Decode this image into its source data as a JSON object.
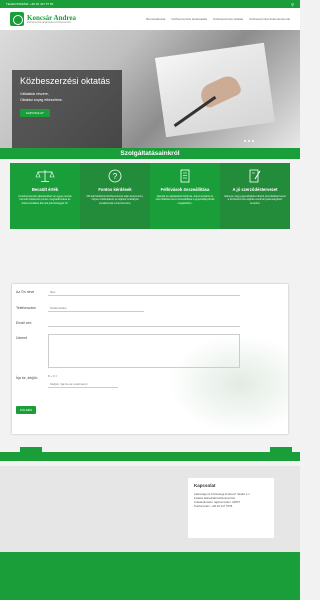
{
  "topbar": {
    "label": "TELEFONSZÁM:",
    "phone": "+36 20 417 57 56",
    "search_icon": "search-icon"
  },
  "header": {
    "logo_name": "Koncsár Andrea",
    "logo_sub": "közbeszerzési tanácsadó és közbeszerzési",
    "nav": [
      "Bemutatkozás",
      "Közbeszerzési tanácsadás",
      "Közbeszerzési oktatás",
      "Közbeszerzési dokumentumok"
    ]
  },
  "hero": {
    "title": "Közbeszerzési oktatás",
    "lines": [
      "Vállalatok részére,",
      "Oktatási anyag elkészítése."
    ],
    "button": "KAPCSOLAT"
  },
  "services": {
    "title": "Szolgáltatásainkról",
    "items": [
      {
        "title": "Becsült érték",
        "text": "A közbeszerzési eljárásokban az egyes részek becsült értékének pontos meghatározása és dokumentálása kiemelt jelentőséggel bír."
      },
      {
        "title": "Fontos kérdések",
        "text": "Mit kell feltétlenül közbeszerzés útján beszerezni, milyen értékhatárok és eljárási szabályok vonatkoznak a beszerzésre."
      },
      {
        "title": "Felhívások összeállítása",
        "text": "Ajánlati és ajánlattételi felhívás, dokumentáció és szerződéstervezet összeállítása a jogszabályoknak megfelelően."
      },
      {
        "title": "A jó szerződéstervezet",
        "text": "Hiányos vagy jogszabályba ütköző szerződéstervezet a közbeszerzési eljárás eredménytelenségéhez vezethet."
      }
    ]
  },
  "form": {
    "name_label": "Az Ön neve",
    "name_placeholder": "Név",
    "phone_label": "Telefonszám",
    "phone_placeholder": "Telefonszám",
    "email_label": "Email cím",
    "message_label": "Üzenet",
    "captcha_label": "Írja be, kérjük: ",
    "captcha_question": "8 + 0 =",
    "captcha_placeholder": "Kérjük, írja be az eredményt",
    "submit": "KÜLDÉS"
  },
  "contact": {
    "title": "Kapcsolat",
    "lines": [
      "Lakossági és Közösségi Andrea K Szabó e.v.",
      "Felelős akkreditált közbeszerzési",
      "szaktanácsadó, lajstromszám: 00537",
      "Telefonszám: +36 20 417 5756"
    ]
  },
  "colors": {
    "brand_green": "#1a9e3a"
  }
}
